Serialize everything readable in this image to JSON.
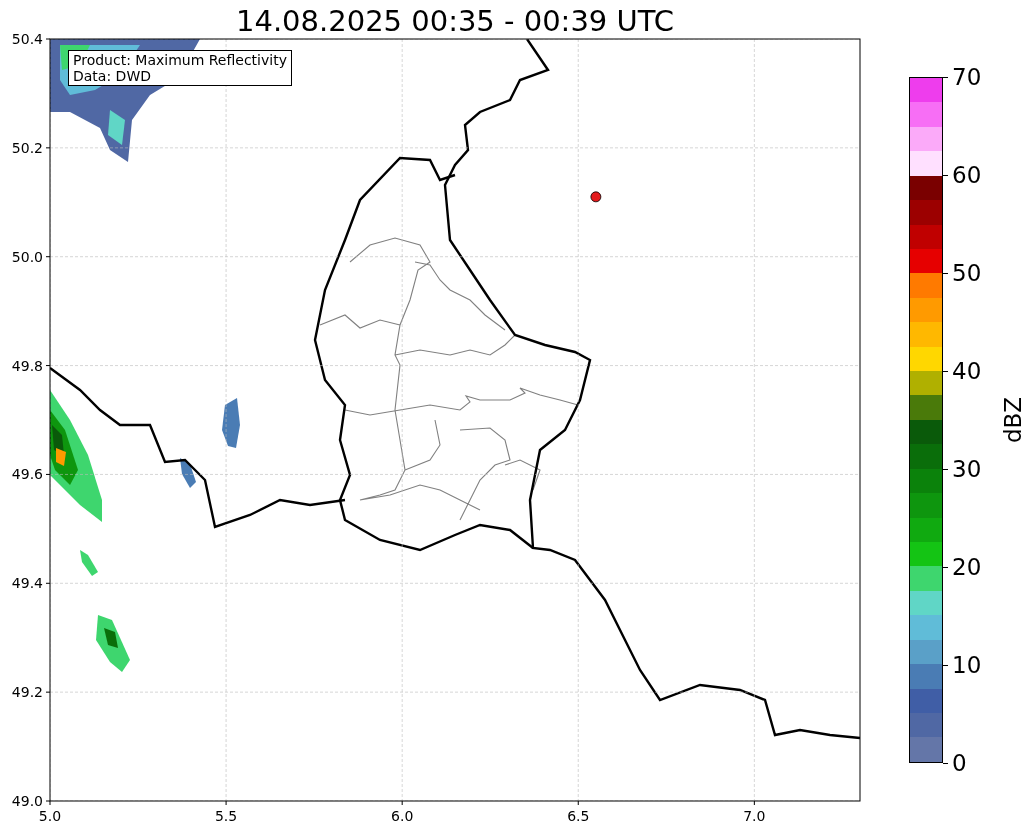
{
  "figure": {
    "title": "14.08.2025 00:35 - 00:39 UTC",
    "annotation": [
      "Product: Maximum Reflectivity",
      "Data: DWD"
    ],
    "chart_data": {
      "type": "scatter",
      "grid": true,
      "xlim": [
        5.0,
        7.3
      ],
      "ylim": [
        49.0,
        50.4
      ],
      "xticks": [
        {
          "value": 5.0,
          "label": "5.0"
        },
        {
          "value": 5.5,
          "label": "5.5"
        },
        {
          "value": 6.0,
          "label": "6.0"
        },
        {
          "value": 6.5,
          "label": "6.5"
        },
        {
          "value": 7.0,
          "label": "7.0"
        }
      ],
      "yticks": [
        {
          "value": 49.0,
          "label": "49.0"
        },
        {
          "value": 49.2,
          "label": "49.2"
        },
        {
          "value": 49.4,
          "label": "49.4"
        },
        {
          "value": 49.6,
          "label": "49.6"
        },
        {
          "value": 49.8,
          "label": "49.8"
        },
        {
          "value": 50.0,
          "label": "50.0"
        },
        {
          "value": 50.2,
          "label": "50.2"
        },
        {
          "value": 50.4,
          "label": "50.4"
        }
      ],
      "x": [
        6.55
      ],
      "series": [
        {
          "color": "#e31a1c",
          "values": [
            50.11
          ]
        }
      ]
    },
    "colorbar": {
      "label": "dBZ",
      "ticks": [
        "70",
        "60",
        "50",
        "40",
        "30",
        "20",
        "10",
        "0"
      ],
      "bands": [
        {
          "color": "#ee3ded"
        },
        {
          "color": "#f76ef5"
        },
        {
          "color": "#fbaaf9"
        },
        {
          "color": "#ffe0ff"
        },
        {
          "color": "#7a0000"
        },
        {
          "color": "#9c0000"
        },
        {
          "color": "#c00000"
        },
        {
          "color": "#e60000"
        },
        {
          "color": "#ff7a00"
        },
        {
          "color": "#ff9a00"
        },
        {
          "color": "#ffb800"
        },
        {
          "color": "#ffd700"
        },
        {
          "color": "#b0b000"
        },
        {
          "color": "#4a7a0a"
        },
        {
          "color": "#0a5a0a"
        },
        {
          "color": "#0a6e0a"
        },
        {
          "color": "#0b820b"
        },
        {
          "color": "#0e960e"
        },
        {
          "color": "#10aa10"
        },
        {
          "color": "#14c414"
        },
        {
          "color": "#3ed66e"
        },
        {
          "color": "#60d6c6"
        },
        {
          "color": "#60bcd8"
        },
        {
          "color": "#5aa0c8"
        },
        {
          "color": "#4a7cb4"
        },
        {
          "color": "#405ea6"
        },
        {
          "color": "#5068a4"
        },
        {
          "color": "#6476a8"
        }
      ]
    }
  }
}
